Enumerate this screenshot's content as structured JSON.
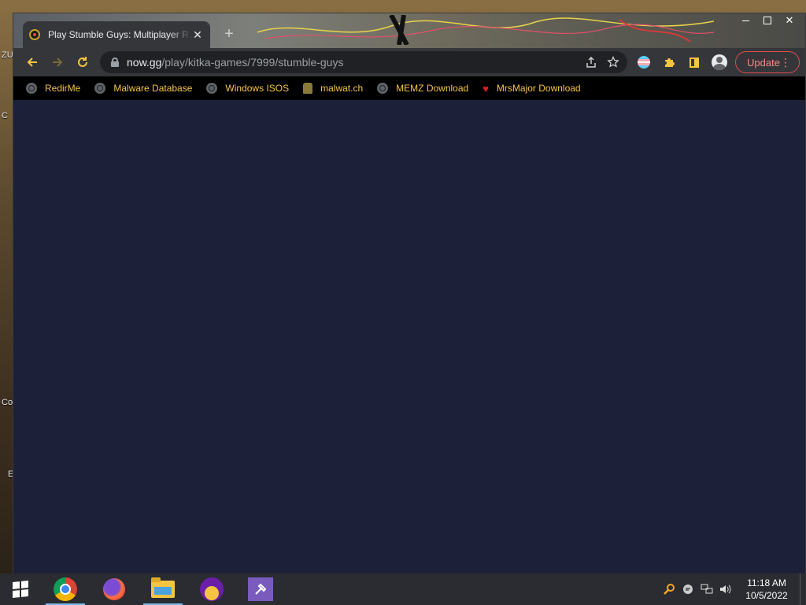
{
  "desktop": {
    "labels": [
      "ZU",
      "C",
      "Co",
      "E"
    ]
  },
  "browser": {
    "tab": {
      "title": "Play Stumble Guys: Multiplayer R",
      "close_glyph": "✕"
    },
    "new_tab_glyph": "+",
    "window_controls": {
      "close_glyph": "✕"
    },
    "address": {
      "host": "now.gg",
      "path": "/play/kitka-games/7999/stumble-guys"
    },
    "update_label": "Update",
    "bookmarks": [
      {
        "label": "RedirMe",
        "icon": "globe-icon"
      },
      {
        "label": "Malware Database",
        "icon": "globe-icon"
      },
      {
        "label": "Windows ISOS",
        "icon": "globe-icon"
      },
      {
        "label": "malwat.ch",
        "icon": "coin-icon"
      },
      {
        "label": "MEMZ Download",
        "icon": "globe-icon"
      },
      {
        "label": "MrsMajor Download",
        "icon": "heart-icon"
      }
    ],
    "colors": {
      "accent": "#f5c542",
      "page_background": "#1c2038",
      "update_border": "#e04a4a"
    }
  },
  "taskbar": {
    "apps": [
      "chrome-icon",
      "firefox-icon",
      "file-explorer-icon",
      "yahoo-messenger-icon",
      "visual-studio-icon"
    ],
    "clock": {
      "time": "11:18 AM",
      "date": "10/5/2022"
    }
  }
}
